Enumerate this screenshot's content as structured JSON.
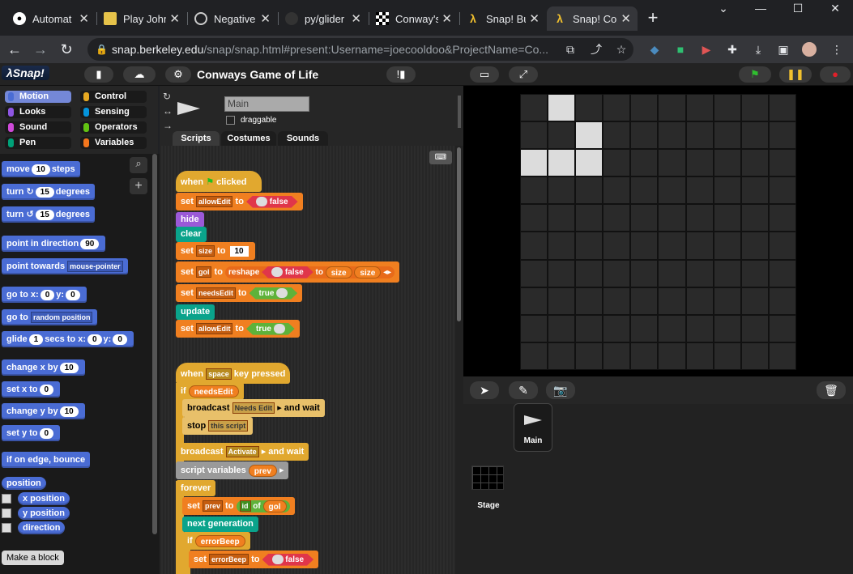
{
  "browser": {
    "tabs": [
      {
        "title": "Automat",
        "icon": "github-icon",
        "active": false
      },
      {
        "title": "Play John",
        "icon": "game-icon",
        "active": false
      },
      {
        "title": "Negative",
        "icon": "openai-icon",
        "active": false
      },
      {
        "title": "py/glider",
        "icon": "github-icon",
        "active": false
      },
      {
        "title": "Conway's",
        "icon": "checker-icon",
        "active": false
      },
      {
        "title": "Snap! Bu",
        "icon": "lambda-icon",
        "active": false
      },
      {
        "title": "Snap! Co",
        "icon": "lambda-icon",
        "active": true
      }
    ],
    "new_tab": "+",
    "url_host": "snap.berkeley.edu",
    "url_path": "/snap/snap.html#present:Username=joecooldoo&ProjectName=Co..."
  },
  "snap": {
    "logo": "λSnap!",
    "project_title": "Conways Game of Life",
    "categories": [
      {
        "label": "Motion",
        "color": "#4a6cd4",
        "selected": true
      },
      {
        "label": "Control",
        "color": "#e6a822"
      },
      {
        "label": "Looks",
        "color": "#8f56e3"
      },
      {
        "label": "Sensing",
        "color": "#0494dc"
      },
      {
        "label": "Sound",
        "color": "#cf4ad9"
      },
      {
        "label": "Operators",
        "color": "#62c213"
      },
      {
        "label": "Pen",
        "color": "#00a178"
      },
      {
        "label": "Variables",
        "color": "#f3761d"
      }
    ],
    "palette": {
      "move": {
        "a": "move",
        "n": "10",
        "b": "steps"
      },
      "turn_cw": {
        "a": "turn",
        "n": "15",
        "b": "degrees"
      },
      "turn_ccw": {
        "a": "turn",
        "n": "15",
        "b": "degrees"
      },
      "point_dir": {
        "a": "point in direction",
        "n": "90"
      },
      "point_towards": {
        "a": "point towards",
        "d": "mouse-pointer"
      },
      "goto_xy": {
        "a": "go to x:",
        "x": "0",
        "b": "y:",
        "y": "0"
      },
      "goto": {
        "a": "go to",
        "d": "random position"
      },
      "glide": {
        "a": "glide",
        "n": "1",
        "b": "secs to x:",
        "x": "0",
        "c": "y:",
        "y": "0"
      },
      "change_x": {
        "a": "change x by",
        "n": "10"
      },
      "set_x": {
        "a": "set x to",
        "n": "0"
      },
      "change_y": {
        "a": "change y by",
        "n": "10"
      },
      "set_y": {
        "a": "set y to",
        "n": "0"
      },
      "bounce": "if on edge, bounce",
      "position": "position",
      "x_position": "x position",
      "y_position": "y position",
      "direction": "direction",
      "make_block": "Make a block"
    },
    "sprite": {
      "name": "Main",
      "draggable": "draggable"
    },
    "sprite_tabs": [
      "Scripts",
      "Costumes",
      "Sounds"
    ],
    "script1": {
      "when": "when",
      "clicked": "clicked",
      "set": "set",
      "to": "to",
      "false": "false",
      "true": "true",
      "allowEdit": "allowEdit",
      "hide": "hide",
      "clear": "clear",
      "size": "size",
      "ten": "10",
      "gol": "gol",
      "reshape": "reshape",
      "needsEdit": "needsEdit",
      "update": "update"
    },
    "script2": {
      "when": "when",
      "key": "space",
      "pressed": "key pressed",
      "if": "if",
      "needsEdit": "needsEdit",
      "broadcast": "broadcast",
      "needs_edit_msg": "Needs Edit",
      "and_wait": "and wait",
      "stop": "stop",
      "this_script": "this script",
      "activate": "Activate",
      "script_variables": "script variables",
      "prev": "prev",
      "forever": "forever",
      "set": "set",
      "to": "to",
      "id": "id",
      "of": "of",
      "gol": "gol",
      "next_generation": "next generation",
      "errorBeep": "errorBeep",
      "false": "false"
    },
    "corral": {
      "sprite_label": "Main",
      "stage_label": "Stage"
    }
  },
  "stage_grid": {
    "rows": 10,
    "cols": 10,
    "live_cells": [
      [
        0,
        1
      ],
      [
        1,
        2
      ],
      [
        2,
        0
      ],
      [
        2,
        1
      ],
      [
        2,
        2
      ]
    ]
  }
}
